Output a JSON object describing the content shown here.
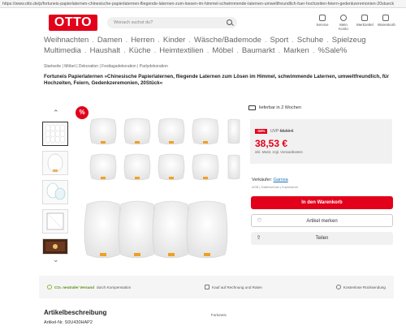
{
  "browser": {
    "url": "https://www.otto.de/p/fortuneis-papierlaternen-chinesische-papierlaternen-fliegende-laternen-zum-loesen-im-himmel-schwimmende-laternen-umweltfreundlich-fuer-hochzeiten-feiern-gedenkzeremonien-20stueck"
  },
  "header": {
    "logo": "OTTO",
    "search_placeholder": "Wonach suchst du?",
    "actions": [
      "Service",
      "Mein Konto",
      "Merkzettel",
      "Warenkorb"
    ]
  },
  "nav": {
    "row1": [
      "Weihnachten",
      "Damen",
      "Herren",
      "Kinder",
      "Wäsche/Bademode",
      "Sport",
      "Schuhe",
      "Spielzeug"
    ],
    "row2": [
      "Multimedia",
      "Haushalt",
      "Küche",
      "Heimtextilien",
      "Möbel",
      "Baumarkt",
      "Marken",
      "%Sale%"
    ],
    "separator": "."
  },
  "breadcrumb": "Startseite | Möbel | Dekoration | Festtagsdekoration | Partydekoration",
  "product": {
    "title": "Fortuneis Papierlaternen »Chinesische Papierlaternen, fliegende Laternen zum Lösen im Himmel, schwimmende Laternen, umweltfreundlich, für Hochzeiten, Feiern, Gedenkzeremonien, 20Stück«",
    "sale_badge": "%",
    "delivery": "lieferbar in 2 Wochen",
    "discount": "-34%",
    "uvp_label": "UVP",
    "uvp_price": "58,53 €",
    "price": "38,53 €",
    "vat_note": "inkl. MwSt. zzgl. Versandkosten",
    "seller_label": "Verkäufer:",
    "seller_name": "Garosa",
    "seller_sub": "AGB | Datenschutz | Impressum",
    "btn_cart": "In den Warenkorb",
    "btn_save": "Artikel merken",
    "btn_share": "Teilen"
  },
  "gallery": {
    "up_arrow": "⌃",
    "down_arrow": "⌄"
  },
  "benefits": {
    "co2_bold": "CO₂ neutraler Versand",
    "co2_rest": "durch Kompensation",
    "invoice": "Kauf auf Rechnung und Raten",
    "returns": "Kostenlose Rücksendung"
  },
  "description": {
    "heading": "Artikelbeschreibung",
    "artnr": "Artikel-Nr. S0U430HAP2",
    "brand": "Fortuneis"
  },
  "colors": {
    "brand_red": "#e2001a",
    "link_blue": "#1a6fb8",
    "green": "#5a8f19"
  }
}
